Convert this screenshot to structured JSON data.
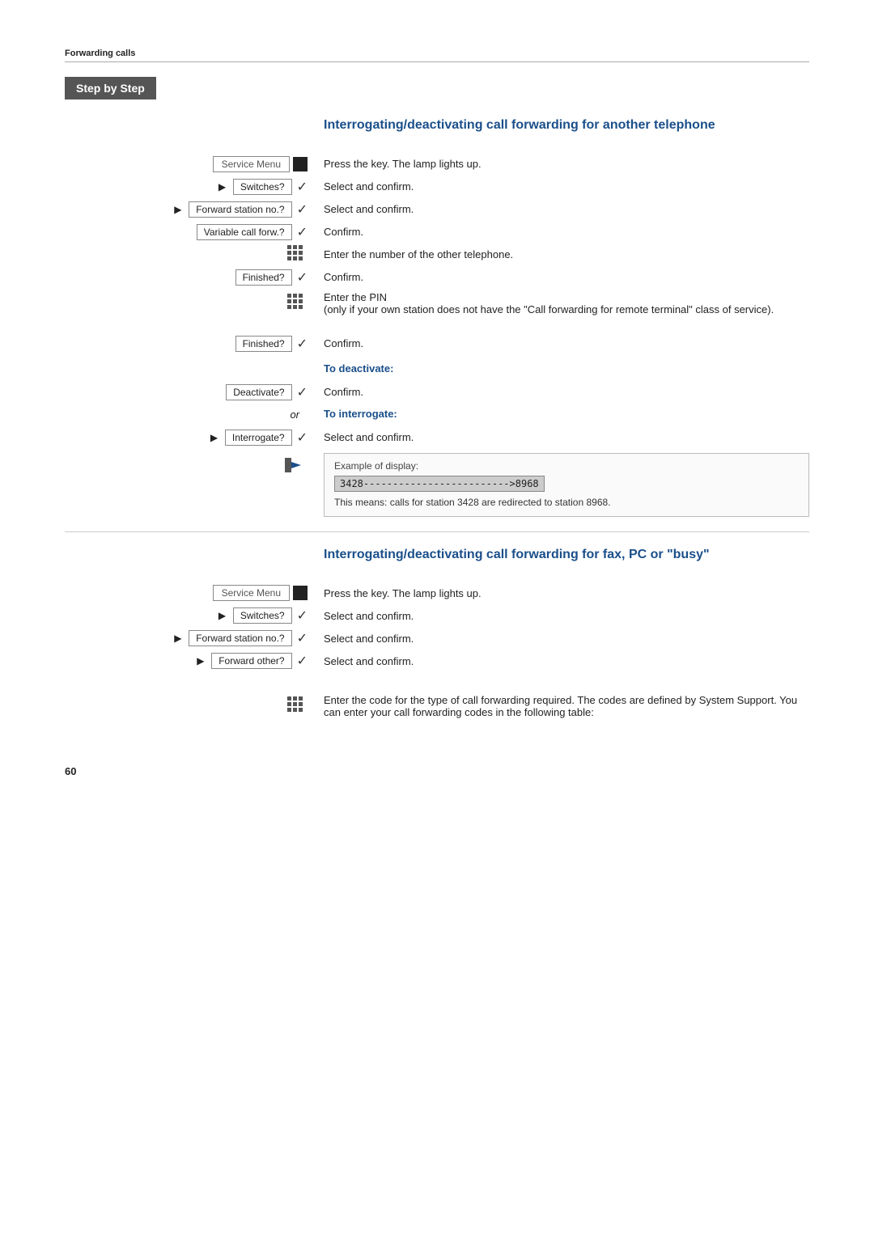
{
  "page": {
    "header": "Forwarding calls",
    "step_by_step": "Step by Step",
    "page_number": "60",
    "section1": {
      "title": "Interrogating/deactivating call forwarding for another telephone",
      "rows": [
        {
          "left_type": "service_menu",
          "left_label": "Service Menu",
          "right_text": "Press the key. The lamp lights up."
        },
        {
          "left_type": "arrow_box_check",
          "arrow": true,
          "box_label": "Switches?",
          "right_text": "Select and confirm."
        },
        {
          "left_type": "arrow_box_check",
          "arrow": true,
          "box_label": "Forward station no.?",
          "right_text": "Select and confirm."
        },
        {
          "left_type": "arrow_box_check",
          "arrow": false,
          "box_label": "Variable call forw.?",
          "right_text": "Confirm."
        },
        {
          "left_type": "keypad",
          "right_text": "Enter the number of the other telephone."
        },
        {
          "left_type": "box_check",
          "box_label": "Finished?",
          "right_text": "Confirm."
        },
        {
          "left_type": "keypad",
          "right_text": "Enter the PIN\n(only if your own station does not have the \"Call forwarding for remote terminal\" class of service)."
        },
        {
          "left_type": "box_check",
          "box_label": "Finished?",
          "right_text": "Confirm."
        },
        {
          "left_type": "subheading",
          "right_subheading": "To deactivate:"
        },
        {
          "left_type": "box_check",
          "box_label": "Deactivate?",
          "right_text": "Confirm."
        },
        {
          "left_type": "or",
          "right_subheading": "To interrogate:"
        },
        {
          "left_type": "arrow_box_check",
          "arrow": true,
          "box_label": "Interrogate?",
          "right_text": "Select and confirm."
        },
        {
          "left_type": "display_example",
          "right_example": {
            "label": "Example of display:",
            "value": "3428------------------------->8968",
            "desc": "This means: calls for station 3428 are redirected to station 8968."
          }
        }
      ]
    },
    "section2": {
      "title": "Interrogating/deactivating call forwarding for fax, PC or \"busy\"",
      "rows": [
        {
          "left_type": "service_menu",
          "left_label": "Service Menu",
          "right_text": "Press the key. The lamp lights up."
        },
        {
          "left_type": "arrow_box_check",
          "arrow": true,
          "box_label": "Switches?",
          "right_text": "Select and confirm."
        },
        {
          "left_type": "arrow_box_check",
          "arrow": true,
          "box_label": "Forward station no.?",
          "right_text": "Select and confirm."
        },
        {
          "left_type": "arrow_box_check",
          "arrow": true,
          "box_label": "Forward other?",
          "right_text": "Select and confirm."
        },
        {
          "left_type": "empty",
          "right_text": ""
        },
        {
          "left_type": "keypad",
          "right_text": "Enter the code for the type of call forwarding required. The codes are defined by System Support. You can enter your call forwarding codes in the following table:"
        }
      ]
    }
  }
}
